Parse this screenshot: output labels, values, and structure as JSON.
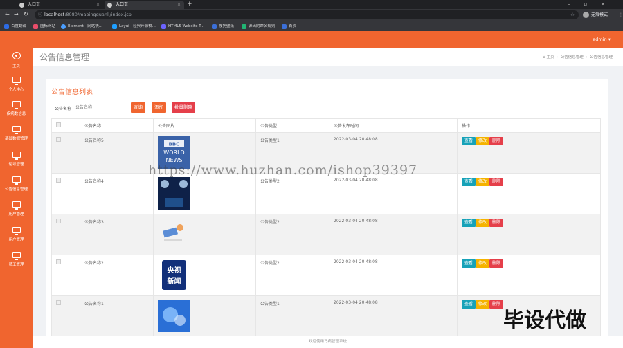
{
  "browser": {
    "tabs": [
      {
        "label": "入口页"
      },
      {
        "label": "入口页"
      }
    ],
    "url_host": "localhost",
    "url_path": ":8080/mabingguanli/index.jsp",
    "profile": "无痕模式",
    "bookmarks": [
      "百度翻译",
      "图标网站",
      "Element - 网站快...",
      "Layui - 经典开源模...",
      "HTML5 Website T...",
      "搜狗壁纸",
      "源码的命名规则",
      "首页"
    ]
  },
  "sidebar": {
    "items": [
      {
        "label": "主页",
        "icon": "home-icon"
      },
      {
        "label": "个人中心",
        "icon": "monitor-icon"
      },
      {
        "label": "疾病数信息",
        "icon": "monitor-icon"
      },
      {
        "label": "基础数据管理",
        "icon": "monitor-icon"
      },
      {
        "label": "论坛管理",
        "icon": "monitor-icon"
      },
      {
        "label": "公告信息管理",
        "icon": "monitor-icon"
      },
      {
        "label": "用户管理",
        "icon": "monitor-icon"
      },
      {
        "label": "用户管理",
        "icon": "monitor-icon"
      },
      {
        "label": "员工管理",
        "icon": "monitor-icon"
      }
    ]
  },
  "header": {
    "user": "admin ▾"
  },
  "page": {
    "title": "公告信息管理",
    "breadcrumb": {
      "home": "主页",
      "level1": "公告信息管理",
      "level2": "公告信息管理"
    }
  },
  "list": {
    "title": "公告信息列表",
    "search_label": "公告名称",
    "search_placeholder": "公告名称",
    "btn_search": "查询",
    "btn_add": "添加",
    "btn_batch_delete": "批量删除",
    "columns": [
      "公告名称",
      "公告图片",
      "公告类型",
      "公告发布时间",
      "操作"
    ],
    "rows": [
      {
        "name": "公告名称5",
        "image": "BBC WORLD NEWS",
        "type": "公告类型1",
        "time": "2022-03-04 20:48:08"
      },
      {
        "name": "公告名称4",
        "image": "",
        "type": "公告类型2",
        "time": "2022-03-04 20:48:08"
      },
      {
        "name": "公告名称3",
        "image": "",
        "type": "公告类型2",
        "time": "2022-03-04 20:48:08"
      },
      {
        "name": "公告名称2",
        "image": "央视新闻",
        "type": "公告类型2",
        "time": "2022-03-04 20:48:08"
      },
      {
        "name": "公告名称1",
        "image": "",
        "type": "公告类型1",
        "time": "2022-03-04 20:48:08"
      }
    ],
    "actions": {
      "view": "查看",
      "edit": "修改",
      "delete": "删除"
    }
  },
  "footer": "欢迎使用马病管理系统",
  "watermark": "https://www.huzhan.com/ishop39397",
  "watermark2": "毕设代做",
  "colors": {
    "accent": "#f0652f",
    "danger": "#e53f4a",
    "info": "#17a2b8",
    "warning": "#f5b300"
  }
}
